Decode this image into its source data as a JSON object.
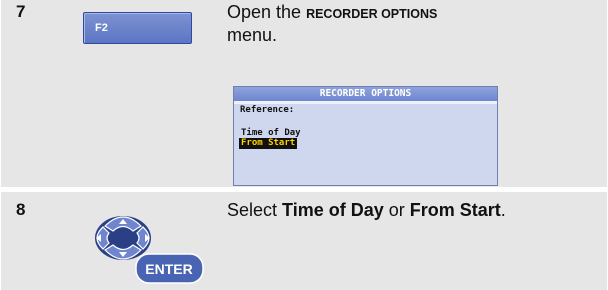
{
  "steps": [
    {
      "number": "7",
      "key_label": "F2",
      "instruction_pre": "Open the ",
      "instruction_menu": "RECORDER OPTIONS",
      "instruction_post": "menu.",
      "screen": {
        "title": "RECORDER OPTIONS",
        "heading": "Reference:",
        "options": [
          "Time of Day",
          "From Start"
        ],
        "selected_option": "From Start"
      }
    },
    {
      "number": "8",
      "key_label": "ENTER",
      "instruction_pre": "Select ",
      "option_a": "Time of Day",
      "instruction_mid": " or ",
      "option_b": "From Start",
      "instruction_post": "."
    }
  ],
  "colors": {
    "row_background": "#e6e6e6",
    "key_blue": "#5b76c4",
    "screen_background": "#cfd7ee",
    "highlight_text": "#ffd200"
  }
}
